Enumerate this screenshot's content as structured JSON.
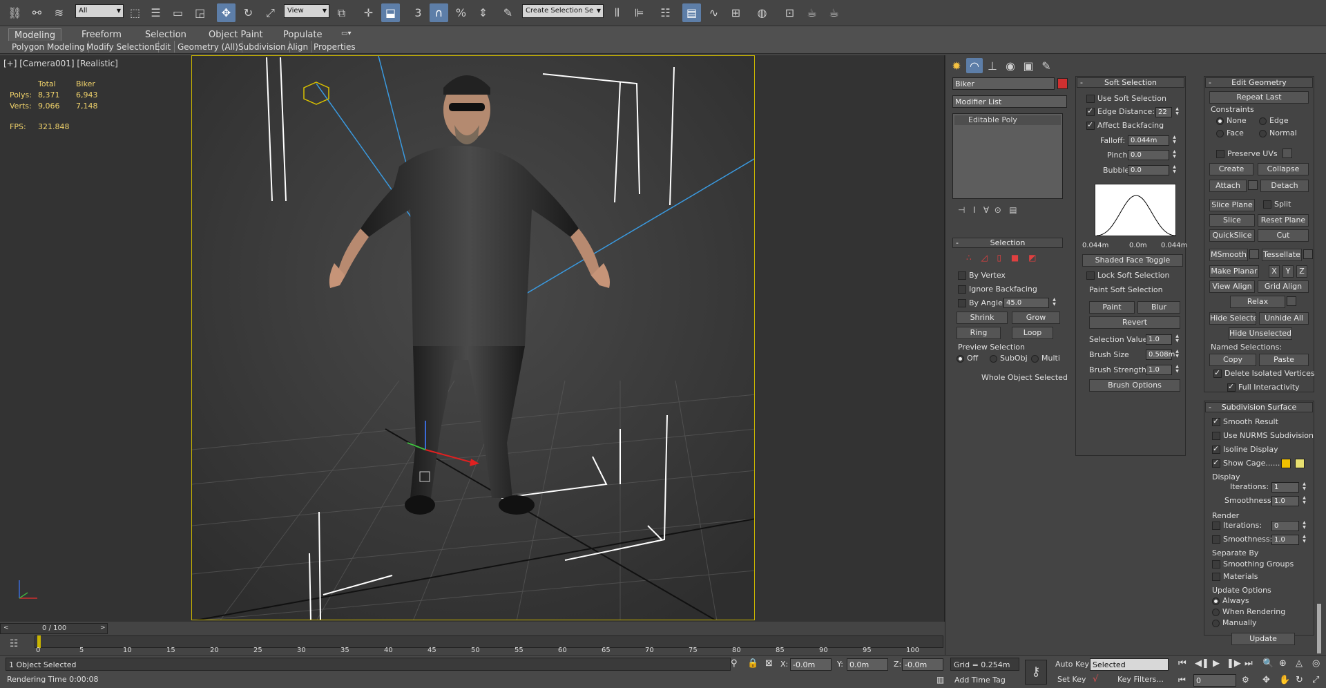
{
  "toolbar": {
    "selection_filter": "All",
    "ref_coord": "View",
    "named_selection": "Create Selection Se"
  },
  "ribbon": {
    "tabs": [
      "Modeling",
      "Freeform",
      "Selection",
      "Object Paint",
      "Populate"
    ],
    "subtabs": [
      "Polygon Modeling",
      "Modify Selection",
      "Edit",
      "Geometry (All)",
      "Subdivision",
      "Align",
      "Properties"
    ]
  },
  "viewport": {
    "label": "[+] [Camera001] [Realistic]",
    "stats": {
      "col_total": "Total",
      "col_obj": "Biker",
      "polys_label": "Polys:",
      "polys_total": "8,371",
      "polys_obj": "6,943",
      "verts_label": "Verts:",
      "verts_total": "9,066",
      "verts_obj": "7,148",
      "fps_label": "FPS:",
      "fps": "321.848"
    }
  },
  "timeline": {
    "slider": "0 / 100",
    "ticks": [
      "0",
      "5",
      "10",
      "15",
      "20",
      "25",
      "30",
      "35",
      "40",
      "45",
      "50",
      "55",
      "60",
      "65",
      "70",
      "75",
      "80",
      "85",
      "90",
      "95",
      "100"
    ]
  },
  "status": {
    "selected": "1 Object Selected",
    "render_time": "Rendering Time  0:00:08",
    "x_label": "X:",
    "x": "-0.0m",
    "y_label": "Y:",
    "y": "0.0m",
    "z_label": "Z:",
    "z": "-0.0m",
    "grid": "Grid = 0.254m",
    "add_time_tag": "Add Time Tag",
    "auto_key": "Auto Key",
    "set_key": "Set Key",
    "key_mode": "Selected",
    "key_filters": "Key Filters...",
    "frame": "0"
  },
  "modifier": {
    "object_name": "Biker",
    "object_color": "#d03030",
    "modifier_list": "Modifier List",
    "stack_item": "Editable Poly"
  },
  "selection": {
    "title": "Selection",
    "by_vertex": "By Vertex",
    "ignore_backfacing": "Ignore Backfacing",
    "by_angle": "By Angle:",
    "angle": "45.0",
    "shrink": "Shrink",
    "grow": "Grow",
    "ring": "Ring",
    "loop": "Loop",
    "preview_title": "Preview Selection",
    "off": "Off",
    "subobj": "SubObj",
    "multi": "Multi",
    "status": "Whole Object Selected"
  },
  "soft": {
    "title": "Soft Selection",
    "use_soft": "Use Soft Selection",
    "edge_distance": "Edge Distance:",
    "edge_val": "22",
    "affect_backfacing": "Affect Backfacing",
    "falloff": "Falloff:",
    "falloff_val": "0.044m",
    "pinch": "Pinch:",
    "pinch_val": "0.0",
    "bubble": "Bubble:",
    "bubble_val": "0.0",
    "curve_left": "0.044m",
    "curve_mid": "0.0m",
    "curve_right": "0.044m",
    "shaded_toggle": "Shaded Face Toggle",
    "lock_soft": "Lock Soft Selection",
    "paint_title": "Paint Soft Selection",
    "paint": "Paint",
    "blur": "Blur",
    "revert": "Revert",
    "sel_value": "Selection Value",
    "sel_value_val": "1.0",
    "brush_size": "Brush Size",
    "brush_size_val": "0.508m",
    "brush_strength": "Brush Strength",
    "brush_strength_val": "1.0",
    "brush_options": "Brush Options"
  },
  "edit": {
    "title": "Edit Geometry",
    "repeat_last": "Repeat Last",
    "constraints": "Constraints",
    "none": "None",
    "edge": "Edge",
    "face": "Face",
    "normal": "Normal",
    "preserve_uvs": "Preserve UVs",
    "create": "Create",
    "collapse": "Collapse",
    "attach": "Attach",
    "detach": "Detach",
    "slice_plane": "Slice Plane",
    "split": "Split",
    "slice": "Slice",
    "reset_plane": "Reset Plane",
    "quickslice": "QuickSlice",
    "cut": "Cut",
    "msmooth": "MSmooth",
    "tessellate": "Tessellate",
    "make_planar": "Make Planar",
    "x": "X",
    "y": "Y",
    "z": "Z",
    "view_align": "View Align",
    "grid_align": "Grid Align",
    "relax": "Relax",
    "hide_selected": "Hide Selected",
    "unhide_all": "Unhide All",
    "hide_unselected": "Hide Unselected",
    "named_selections": "Named Selections:",
    "copy": "Copy",
    "paste": "Paste",
    "delete_isolated": "Delete Isolated Vertices",
    "full_interactivity": "Full Interactivity"
  },
  "subdiv": {
    "title": "Subdivision Surface",
    "smooth_result": "Smooth Result",
    "use_nurms": "Use NURMS Subdivision",
    "isoline": "Isoline Display",
    "show_cage": "Show Cage......",
    "cage_color1": "#f0c000",
    "cage_color2": "#e8e070",
    "display": "Display",
    "iterations": "Iterations:",
    "iter_val": "1",
    "smoothness": "Smoothness:",
    "smooth_val": "1.0",
    "render": "Render",
    "r_iter_val": "0",
    "r_smooth_val": "1.0",
    "separate_by": "Separate By",
    "smoothing_groups": "Smoothing Groups",
    "materials": "Materials",
    "update_options": "Update Options",
    "always": "Always",
    "when_rendering": "When Rendering",
    "manually": "Manually",
    "update": "Update"
  }
}
